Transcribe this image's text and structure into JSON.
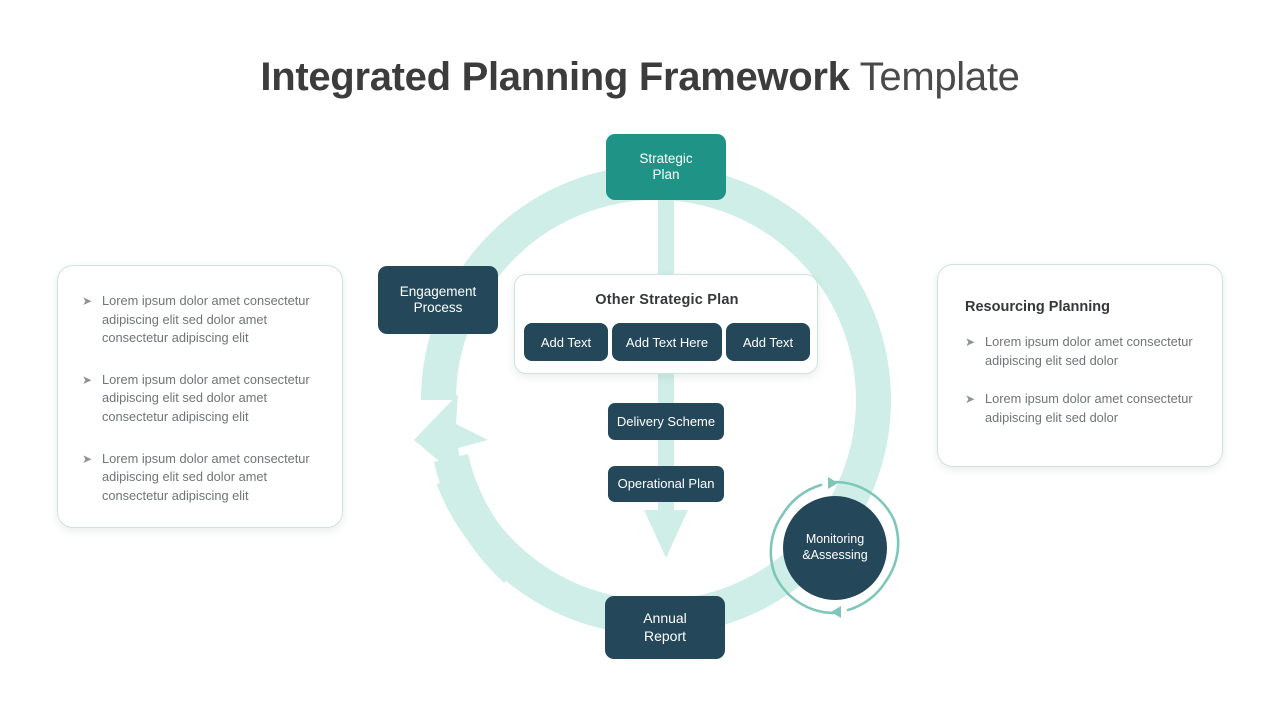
{
  "title": {
    "bold_part": "Integrated Planning Framework",
    "light_part": " Template"
  },
  "colors": {
    "teal_accent": "#1f9486",
    "dark_navy": "#24485a",
    "light_teal_ring": "#cfeee8",
    "mid_teal_arrow": "#7fc6ba",
    "card_border": "#cfe3de",
    "body_text": "#6f7477"
  },
  "nodes": {
    "strategic_plan": "Strategic\nPlan",
    "strategic_plan_line1": "Strategic",
    "strategic_plan_line2": "Plan",
    "engagement_process_line1": "Engagement",
    "engagement_process_line2": "Process",
    "delivery_scheme": "Delivery Scheme",
    "operational_plan": "Operational Plan",
    "annual_report_line1": "Annual",
    "annual_report_line2": "Report",
    "monitoring_line1": "Monitoring",
    "monitoring_line2": "&Assessing"
  },
  "center_card": {
    "title": "Other  Strategic Plan",
    "buttons": [
      {
        "label": "Add Text"
      },
      {
        "label": "Add Text Here"
      },
      {
        "label": "Add Text"
      }
    ]
  },
  "left_card": {
    "bullet_marker": "➤",
    "bullets": [
      "Lorem ipsum dolor amet consectetur adipiscing elit sed dolor amet consectetur adipiscing elit",
      "Lorem ipsum dolor amet consectetur adipiscing elit sed dolor amet consectetur adipiscing elit",
      "Lorem ipsum dolor amet consectetur adipiscing elit sed dolor amet consectetur adipiscing elit"
    ]
  },
  "right_card": {
    "title": "Resourcing Planning",
    "bullet_marker": "➤",
    "bullets": [
      "Lorem ipsum dolor amet consectetur adipiscing elit sed dolor",
      "Lorem ipsum dolor amet consectetur adipiscing elit sed dolor"
    ]
  }
}
